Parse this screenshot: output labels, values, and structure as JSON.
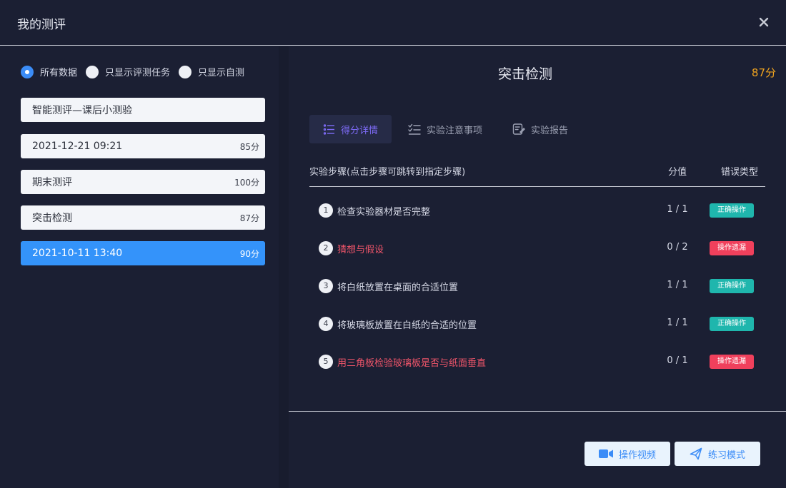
{
  "window": {
    "title": "我的测评"
  },
  "filters": [
    {
      "label": "所有数据",
      "checked": true
    },
    {
      "label": "只显示评测任务",
      "checked": false
    },
    {
      "label": "只显示自测",
      "checked": false
    }
  ],
  "records": [
    {
      "name": "智能测评—课后小测验",
      "score": "",
      "active": false
    },
    {
      "name": "2021-12-21 09:21",
      "score": "85分",
      "active": false
    },
    {
      "name": "期末测评",
      "score": "100分",
      "active": false
    },
    {
      "name": "突击检测",
      "score": "87分",
      "active": false
    },
    {
      "name": "2021-10-11 13:40",
      "score": "90分",
      "active": true
    }
  ],
  "detail": {
    "title": "突击检测",
    "total": "87分",
    "tabs": [
      {
        "label": "得分详情",
        "icon": "list-icon",
        "active": true
      },
      {
        "label": "实验注意事项",
        "icon": "checklist-icon",
        "active": false
      },
      {
        "label": "实验报告",
        "icon": "report-icon",
        "active": false
      }
    ],
    "columns": {
      "step": "实验步骤(点击步骤可跳转到指定步骤)",
      "score": "分值",
      "type": "错误类型"
    },
    "steps": [
      {
        "num": "1",
        "name": "检查实验器材是否完整",
        "score": "1 / 1",
        "type": "正确操作",
        "error": false
      },
      {
        "num": "2",
        "name": "猜想与假设",
        "score": "0 / 2",
        "type": "操作遗漏",
        "error": true
      },
      {
        "num": "3",
        "name": "将白纸放置在桌面的合适位置",
        "score": "1 / 1",
        "type": "正确操作",
        "error": false
      },
      {
        "num": "4",
        "name": "将玻璃板放置在白纸的合适的位置",
        "score": "1 / 1",
        "type": "正确操作",
        "error": false
      },
      {
        "num": "5",
        "name": "用三角板检验玻璃板是否与纸面垂直",
        "score": "0 / 1",
        "type": "操作遗漏",
        "error": true
      }
    ],
    "buttons": {
      "video": "操作视频",
      "practice": "练习模式"
    }
  },
  "colors": {
    "accent": "#3b8cf7",
    "score": "#f2a51f",
    "ok": "#1fb6ad",
    "bad": "#f0405c",
    "tab_active": "#7e6bf7"
  }
}
